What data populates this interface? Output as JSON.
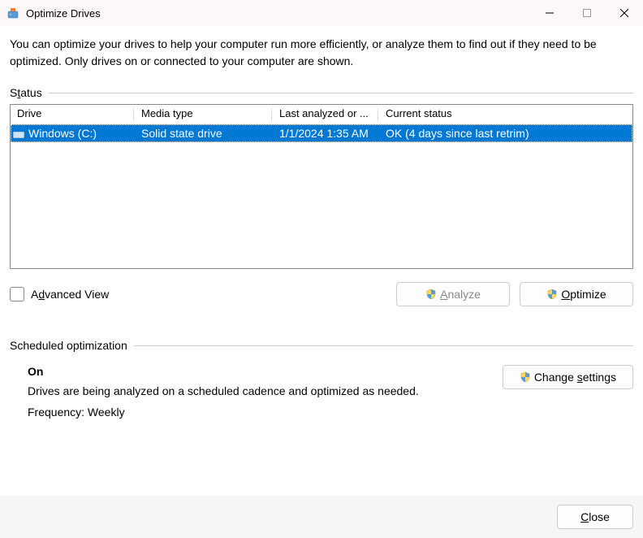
{
  "window": {
    "title": "Optimize Drives"
  },
  "intro": "You can optimize your drives to help your computer run more efficiently, or analyze them to find out if they need to be optimized. Only drives on or connected to your computer are shown.",
  "status": {
    "label_pre": "S",
    "label_u": "t",
    "label_post": "atus",
    "columns": {
      "drive": "Drive",
      "media": "Media type",
      "last": "Last analyzed or ...",
      "status": "Current status"
    },
    "rows": [
      {
        "name": "Windows (C:)",
        "media": "Solid state drive",
        "last": "1/1/2024 1:35 AM",
        "status": "OK (4 days since last retrim)"
      }
    ]
  },
  "advanced": {
    "pre": "A",
    "u": "d",
    "post": "vanced View"
  },
  "buttons": {
    "analyze_u": "A",
    "analyze_post": "nalyze",
    "optimize_u": "O",
    "optimize_post": "ptimize",
    "change_pre": "Change ",
    "change_u": "s",
    "change_post": "ettings",
    "close_u": "C",
    "close_post": "lose"
  },
  "scheduled": {
    "label": "Scheduled optimization",
    "on": "On",
    "desc": "Drives are being analyzed on a scheduled cadence and optimized as needed.",
    "freq": "Frequency: Weekly"
  }
}
